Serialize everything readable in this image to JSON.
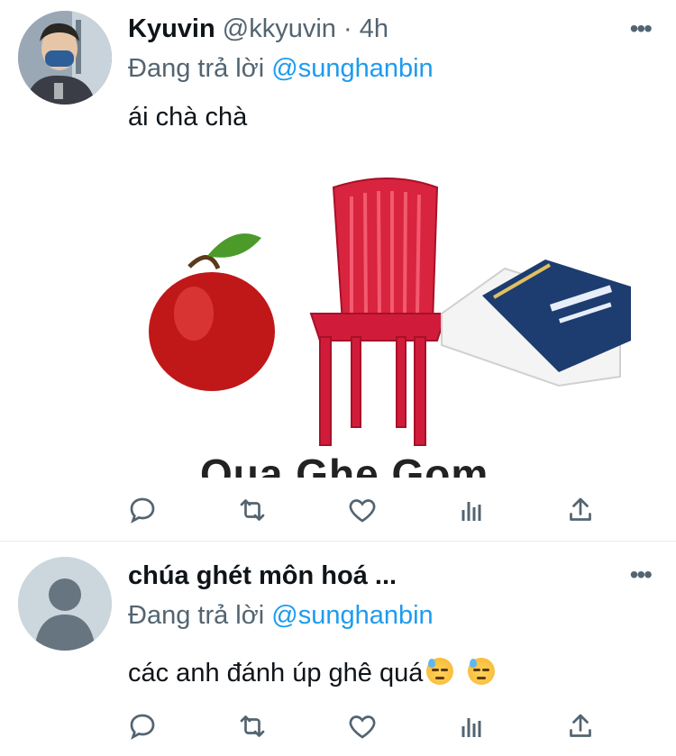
{
  "tweets": [
    {
      "name": "Kyuvin",
      "handle": "@kkyuvin",
      "separator": "·",
      "time": "4h",
      "reply_prefix": "Đang trả lời",
      "reply_to": "@sunghanbin",
      "text": "ái chà chà",
      "image_caption": "Qua Ghe Gom",
      "more_label": "•••"
    },
    {
      "name": "chúa ghét môn hoá ...",
      "reply_prefix": "Đang trả lời",
      "reply_to": "@sunghanbin",
      "text": "các anh đánh úp ghê quá",
      "emoji_names": [
        "downcast-face-with-sweat",
        "downcast-face-with-sweat"
      ],
      "more_label": "•••"
    }
  ],
  "action_icons": [
    "reply-icon",
    "retweet-icon",
    "like-icon",
    "stats-icon",
    "share-icon"
  ],
  "colors": {
    "text": "#0f1419",
    "secondary": "#536471",
    "mention": "#1d9bf0",
    "divider": "#e6ecf0"
  }
}
